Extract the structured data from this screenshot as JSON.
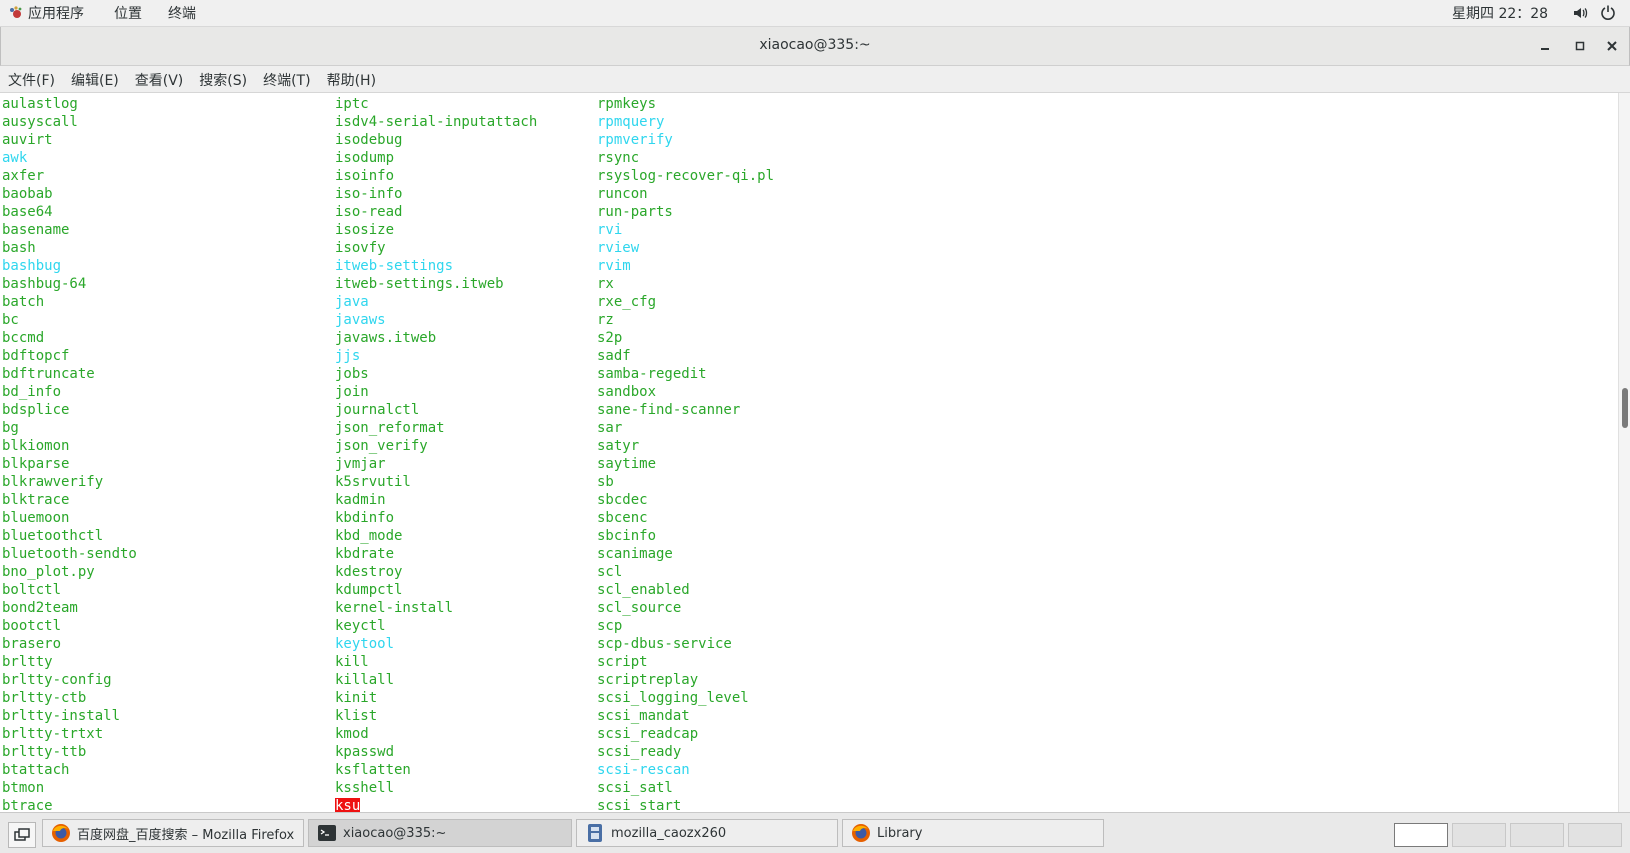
{
  "topbar": {
    "applications": "应用程序",
    "places": "位置",
    "terminal": "终端",
    "clock": "星期四 22：28"
  },
  "window": {
    "title": "xiaocao@335:~"
  },
  "menubar": {
    "items": [
      "文件(F)",
      "编辑(E)",
      "查看(V)",
      "搜索(S)",
      "终端(T)",
      "帮助(H)"
    ]
  },
  "terminal": {
    "columns": [
      [
        {
          "text": "aulastlog",
          "color": "green"
        },
        {
          "text": "ausyscall",
          "color": "green"
        },
        {
          "text": "auvirt",
          "color": "green"
        },
        {
          "text": "awk",
          "color": "cyan"
        },
        {
          "text": "axfer",
          "color": "green"
        },
        {
          "text": "baobab",
          "color": "green"
        },
        {
          "text": "base64",
          "color": "green"
        },
        {
          "text": "basename",
          "color": "green"
        },
        {
          "text": "bash",
          "color": "green"
        },
        {
          "text": "bashbug",
          "color": "cyan"
        },
        {
          "text": "bashbug-64",
          "color": "green"
        },
        {
          "text": "batch",
          "color": "green"
        },
        {
          "text": "bc",
          "color": "green"
        },
        {
          "text": "bccmd",
          "color": "green"
        },
        {
          "text": "bdftopcf",
          "color": "green"
        },
        {
          "text": "bdftruncate",
          "color": "green"
        },
        {
          "text": "bd_info",
          "color": "green"
        },
        {
          "text": "bdsplice",
          "color": "green"
        },
        {
          "text": "bg",
          "color": "green"
        },
        {
          "text": "blkiomon",
          "color": "green"
        },
        {
          "text": "blkparse",
          "color": "green"
        },
        {
          "text": "blkrawverify",
          "color": "green"
        },
        {
          "text": "blktrace",
          "color": "green"
        },
        {
          "text": "bluemoon",
          "color": "green"
        },
        {
          "text": "bluetoothctl",
          "color": "green"
        },
        {
          "text": "bluetooth-sendto",
          "color": "green"
        },
        {
          "text": "bno_plot.py",
          "color": "green"
        },
        {
          "text": "boltctl",
          "color": "green"
        },
        {
          "text": "bond2team",
          "color": "green"
        },
        {
          "text": "bootctl",
          "color": "green"
        },
        {
          "text": "brasero",
          "color": "green"
        },
        {
          "text": "brltty",
          "color": "green"
        },
        {
          "text": "brltty-config",
          "color": "green"
        },
        {
          "text": "brltty-ctb",
          "color": "green"
        },
        {
          "text": "brltty-install",
          "color": "green"
        },
        {
          "text": "brltty-trtxt",
          "color": "green"
        },
        {
          "text": "brltty-ttb",
          "color": "green"
        },
        {
          "text": "btattach",
          "color": "green"
        },
        {
          "text": "btmon",
          "color": "green"
        },
        {
          "text": "btrace",
          "color": "green"
        }
      ],
      [
        {
          "text": "iptc",
          "color": "green"
        },
        {
          "text": "isdv4-serial-inputattach",
          "color": "green"
        },
        {
          "text": "isodebug",
          "color": "green"
        },
        {
          "text": "isodump",
          "color": "green"
        },
        {
          "text": "isoinfo",
          "color": "green"
        },
        {
          "text": "iso-info",
          "color": "green"
        },
        {
          "text": "iso-read",
          "color": "green"
        },
        {
          "text": "isosize",
          "color": "green"
        },
        {
          "text": "isovfy",
          "color": "green"
        },
        {
          "text": "itweb-settings",
          "color": "cyan"
        },
        {
          "text": "itweb-settings.itweb",
          "color": "green"
        },
        {
          "text": "java",
          "color": "cyan"
        },
        {
          "text": "javaws",
          "color": "cyan"
        },
        {
          "text": "javaws.itweb",
          "color": "green"
        },
        {
          "text": "jjs",
          "color": "cyan"
        },
        {
          "text": "jobs",
          "color": "green"
        },
        {
          "text": "join",
          "color": "green"
        },
        {
          "text": "journalctl",
          "color": "green"
        },
        {
          "text": "json_reformat",
          "color": "green"
        },
        {
          "text": "json_verify",
          "color": "green"
        },
        {
          "text": "jvmjar",
          "color": "green"
        },
        {
          "text": "k5srvutil",
          "color": "green"
        },
        {
          "text": "kadmin",
          "color": "green"
        },
        {
          "text": "kbdinfo",
          "color": "green"
        },
        {
          "text": "kbd_mode",
          "color": "green"
        },
        {
          "text": "kbdrate",
          "color": "green"
        },
        {
          "text": "kdestroy",
          "color": "green"
        },
        {
          "text": "kdumpctl",
          "color": "green"
        },
        {
          "text": "kernel-install",
          "color": "green"
        },
        {
          "text": "keyctl",
          "color": "green"
        },
        {
          "text": "keytool",
          "color": "cyan"
        },
        {
          "text": "kill",
          "color": "green"
        },
        {
          "text": "killall",
          "color": "green"
        },
        {
          "text": "kinit",
          "color": "green"
        },
        {
          "text": "klist",
          "color": "green"
        },
        {
          "text": "kmod",
          "color": "green"
        },
        {
          "text": "kpasswd",
          "color": "green"
        },
        {
          "text": "ksflatten",
          "color": "green"
        },
        {
          "text": "ksshell",
          "color": "green"
        },
        {
          "text": "ksu",
          "color": "red"
        }
      ],
      [
        {
          "text": "rpmkeys",
          "color": "green"
        },
        {
          "text": "rpmquery",
          "color": "cyan"
        },
        {
          "text": "rpmverify",
          "color": "cyan"
        },
        {
          "text": "rsync",
          "color": "green"
        },
        {
          "text": "rsyslog-recover-qi.pl",
          "color": "green"
        },
        {
          "text": "runcon",
          "color": "green"
        },
        {
          "text": "run-parts",
          "color": "green"
        },
        {
          "text": "rvi",
          "color": "cyan"
        },
        {
          "text": "rview",
          "color": "cyan"
        },
        {
          "text": "rvim",
          "color": "cyan"
        },
        {
          "text": "rx",
          "color": "green"
        },
        {
          "text": "rxe_cfg",
          "color": "green"
        },
        {
          "text": "rz",
          "color": "green"
        },
        {
          "text": "s2p",
          "color": "green"
        },
        {
          "text": "sadf",
          "color": "green"
        },
        {
          "text": "samba-regedit",
          "color": "green"
        },
        {
          "text": "sandbox",
          "color": "green"
        },
        {
          "text": "sane-find-scanner",
          "color": "green"
        },
        {
          "text": "sar",
          "color": "green"
        },
        {
          "text": "satyr",
          "color": "green"
        },
        {
          "text": "saytime",
          "color": "green"
        },
        {
          "text": "sb",
          "color": "green"
        },
        {
          "text": "sbcdec",
          "color": "green"
        },
        {
          "text": "sbcenc",
          "color": "green"
        },
        {
          "text": "sbcinfo",
          "color": "green"
        },
        {
          "text": "scanimage",
          "color": "green"
        },
        {
          "text": "scl",
          "color": "green"
        },
        {
          "text": "scl_enabled",
          "color": "green"
        },
        {
          "text": "scl_source",
          "color": "green"
        },
        {
          "text": "scp",
          "color": "green"
        },
        {
          "text": "scp-dbus-service",
          "color": "green"
        },
        {
          "text": "script",
          "color": "green"
        },
        {
          "text": "scriptreplay",
          "color": "green"
        },
        {
          "text": "scsi_logging_level",
          "color": "green"
        },
        {
          "text": "scsi_mandat",
          "color": "green"
        },
        {
          "text": "scsi_readcap",
          "color": "green"
        },
        {
          "text": "scsi_ready",
          "color": "green"
        },
        {
          "text": "scsi-rescan",
          "color": "cyan"
        },
        {
          "text": "scsi_satl",
          "color": "green"
        },
        {
          "text": "scsi_start",
          "color": "green"
        }
      ]
    ]
  },
  "taskbar": {
    "items": [
      {
        "label": "百度网盘_百度搜索 – Mozilla Firefox",
        "icon": "firefox-icon"
      },
      {
        "label": "xiaocao@335:~",
        "icon": "terminal-icon"
      },
      {
        "label": "mozilla_caozx260",
        "icon": "file-manager-icon"
      },
      {
        "label": "Library",
        "icon": "firefox-icon"
      }
    ]
  }
}
